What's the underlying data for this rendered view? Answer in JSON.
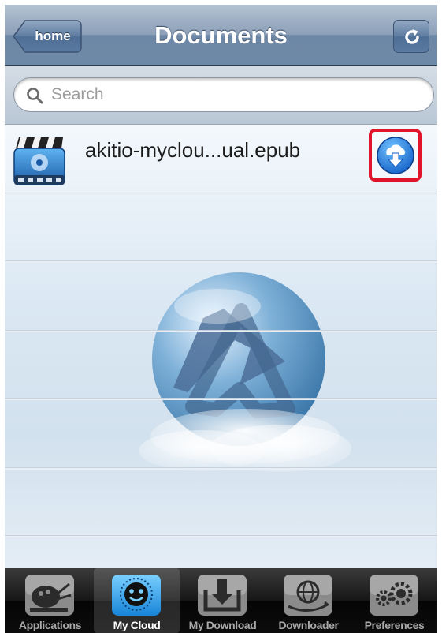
{
  "navbar": {
    "back_label": "home",
    "title": "Documents",
    "refresh_icon": "refresh-icon"
  },
  "search": {
    "placeholder": "Search",
    "value": "",
    "icon": "search-icon"
  },
  "files": [
    {
      "name": "akitio-myclou...ual.epub",
      "icon": "video-clapper-icon",
      "action_icon": "cloud-download-icon"
    }
  ],
  "tabs": [
    {
      "label": "Applications",
      "icon": "palette-icon",
      "selected": false
    },
    {
      "label": "My Cloud",
      "icon": "cloud-smiley-icon",
      "selected": true
    },
    {
      "label": "My Download",
      "icon": "download-tray-icon",
      "selected": false
    },
    {
      "label": "Downloader",
      "icon": "globe-icon",
      "selected": false
    },
    {
      "label": "Preferences",
      "icon": "gears-icon",
      "selected": false
    }
  ],
  "colors": {
    "accent": "#1f7ad6",
    "highlight_border": "#e0142a",
    "navbar": "#7a92b0",
    "tabbar": "#111111"
  }
}
